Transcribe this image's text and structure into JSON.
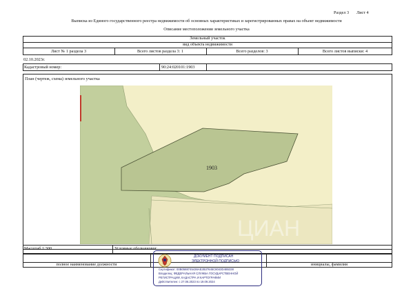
{
  "header": {
    "section": "Раздел 3",
    "sheet": "Лист 4",
    "title": "Выписка из Единого государственного реестра недвижимости об основных характеристиках и зарегистрированных правах на объект недвижимости",
    "subtitle": "Описание местоположения земельного участка"
  },
  "object": {
    "kind": "Земельный участок",
    "kind_caption": "вид объекта недвижимости"
  },
  "sheet_info": {
    "sheet_no": "Лист № 1 раздела 3",
    "sheets_in_section": "Всего листов раздела 3: 1",
    "sections_total": "Всего разделов: 3",
    "sheets_total": "Всего листов выписки: 4"
  },
  "date": "02.10.2023г.",
  "cadastral": {
    "label": "Кадастровый номер:",
    "value": "90:24:020101:1903"
  },
  "plan": {
    "caption": "План (чертеж, схема) земельного участка",
    "parcel_label": "1903",
    "colors": {
      "background": "#f3efc8",
      "parcel": "#b9c592",
      "greenfield": "#c2cf9d",
      "road": "#ece7c0"
    }
  },
  "legend": {
    "scale": "Масштаб 1:300",
    "symbols": "Условные обозначения:"
  },
  "footer": {
    "position_caption": "полное наименование должности",
    "initials_caption": "инициалы, фамилия"
  },
  "stamp": {
    "title1": "ДОКУМЕНТ ПОДПИСАН",
    "title2": "ЭЛЕКТРОННОЙ ПОДПИСЬЮ",
    "cert": "Сертификат: 00B0588745436AE2B37645C8043D4B5338",
    "owner1": "Владелец: ФЕДЕРАЛЬНАЯ СЛУЖБА ГОСУДАРСТВЕННОЙ",
    "owner2": "РЕГИСТРАЦИИ, КАДАСТРА И КАРТОГРАФИИ",
    "valid": "Действителен: с 27.06.2023 по 19.09.2024"
  },
  "watermark": "ЦИАН"
}
